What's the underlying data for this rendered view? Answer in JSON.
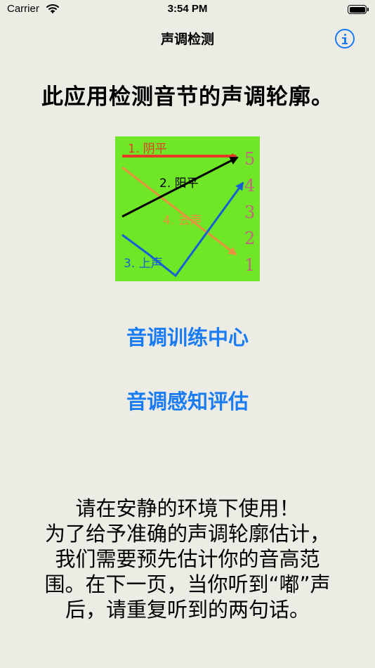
{
  "status": {
    "carrier": "Carrier",
    "time": "3:54 PM"
  },
  "nav": {
    "title": "声调检测",
    "info_icon": "info-icon"
  },
  "heading": "此应用检测音节的声调轮廓。",
  "diagram": {
    "background": "#6fe726",
    "tones": [
      {
        "label": "1. 阴平",
        "color": "#e43a26"
      },
      {
        "label": "2. 阳平",
        "color": "#000000"
      },
      {
        "label": "3. 上声",
        "color": "#1660d4"
      },
      {
        "label": "4. 去声",
        "color": "#e8923e"
      }
    ],
    "scale": [
      "5",
      "4",
      "3",
      "2",
      "1"
    ],
    "scale_color": "#c0667e"
  },
  "buttons": {
    "training": "音调训练中心",
    "assessment": "音调感知评估"
  },
  "notice": {
    "lines": [
      "请在安静的环境下使用！",
      "为了给予准确的声调轮廓估计，",
      "我们需要预先估计你的音高范",
      "围。在下一页，当你听到“嘟”声",
      "后，请重复听到的两句话。"
    ]
  }
}
